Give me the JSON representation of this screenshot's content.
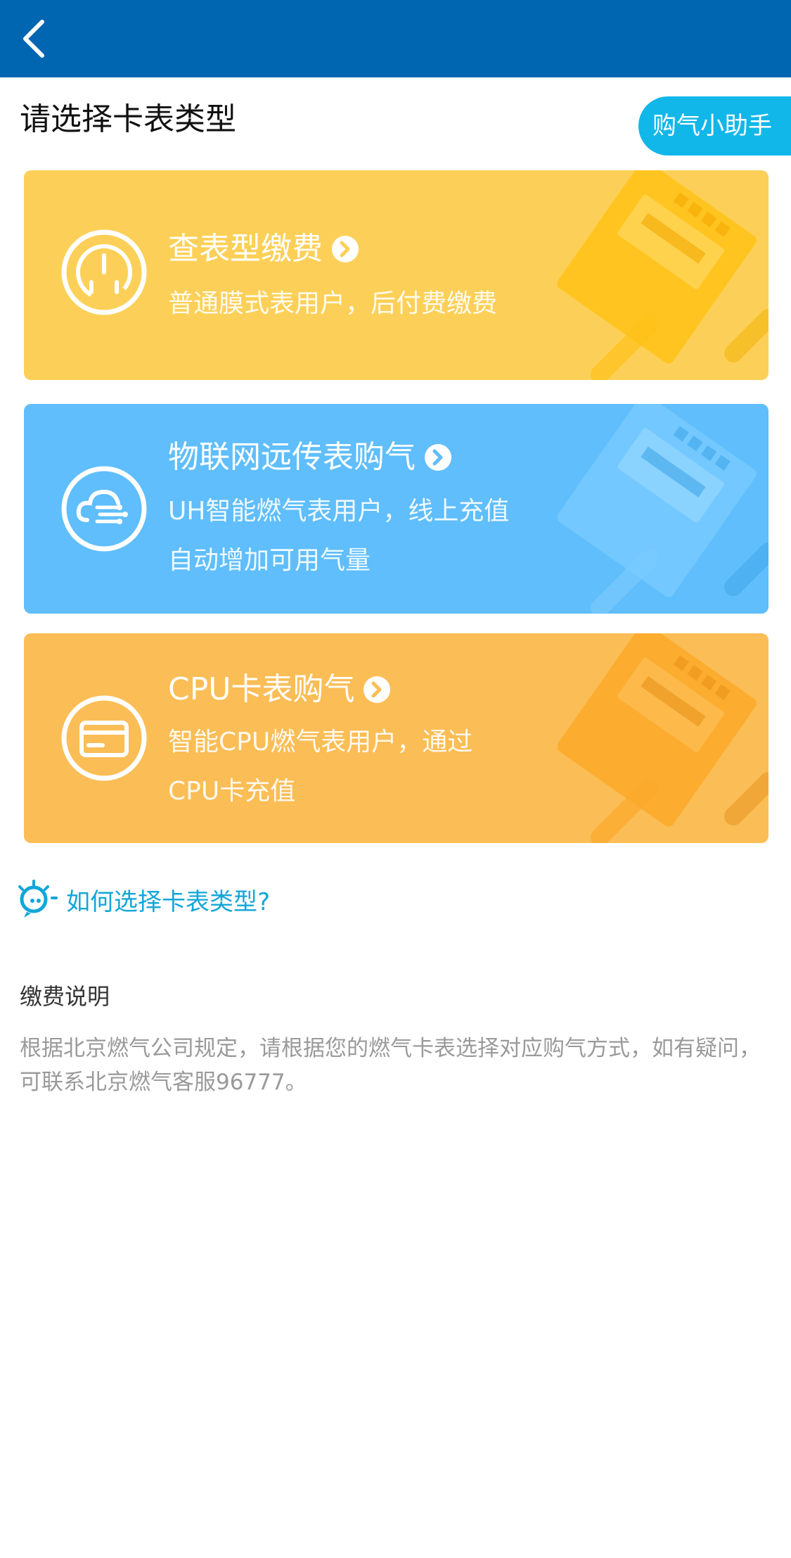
{
  "header": {
    "back_icon": "chevron-left-icon",
    "bg_color": "#0066B1"
  },
  "page": {
    "title": "请选择卡表类型",
    "helper_button": "购气小助手"
  },
  "cards": [
    {
      "title": "查表型缴费",
      "desc_lines": [
        "普通膜式表用户，后付费缴费"
      ],
      "icon": "gauge-icon",
      "color": "#FCD058"
    },
    {
      "title": "物联网远传表购气",
      "desc_lines": [
        "UH智能燃气表用户，线上充值",
        "自动增加可用气量"
      ],
      "icon": "cloud-network-icon",
      "color": "#5FBEFB"
    },
    {
      "title": "CPU卡表购气",
      "desc_lines": [
        "智能CPU燃气表用户，通过",
        "CPU卡充值"
      ],
      "icon": "card-icon",
      "color": "#FBBD55"
    }
  ],
  "help": {
    "link": "如何选择卡表类型?",
    "icon": "lightbulb-icon"
  },
  "payment_note": {
    "title": "缴费说明",
    "body": "根据北京燃气公司规定，请根据您的燃气卡表选择对应购气方式，如有疑问，可联系北京燃气客服96777。"
  }
}
